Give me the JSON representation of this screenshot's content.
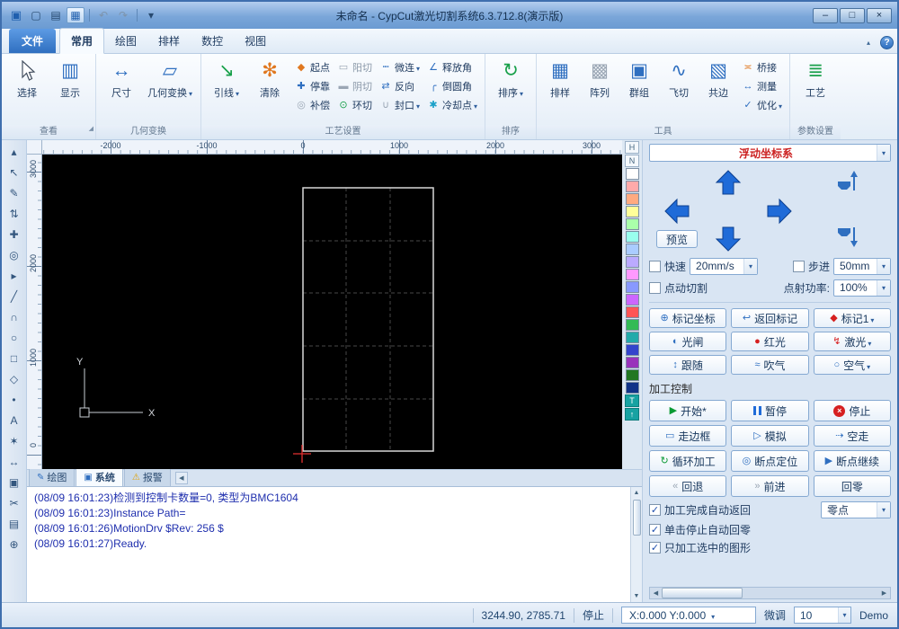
{
  "colors": {
    "accent": "#2f6fc0",
    "start_green": "#0a9a34",
    "stop_red": "#d62020",
    "warning_yellow": "#e0a000",
    "coord_red": "#cc2222",
    "canvas_bg": "#000000"
  },
  "titlebar": {
    "title": "未命名 - CypCut激光切割系统6.3.712.8(演示版)"
  },
  "window_controls": {
    "minimize": "–",
    "maximize": "□",
    "close": "×"
  },
  "qat": {
    "icons": [
      {
        "name": "app-icon",
        "glyph": "▣",
        "cls": "app"
      },
      {
        "name": "new-file-icon",
        "glyph": "▢",
        "cls": ""
      },
      {
        "name": "open-file-icon",
        "glyph": "▤",
        "cls": ""
      },
      {
        "name": "save-icon",
        "glyph": "▦",
        "cls": "save"
      },
      {
        "name": "undo-icon",
        "glyph": "↶",
        "cls": "disabled"
      },
      {
        "name": "redo-icon",
        "glyph": "↷",
        "cls": "disabled"
      },
      {
        "name": "qat-more-icon",
        "glyph": "▾",
        "cls": ""
      }
    ]
  },
  "help_label": "?",
  "menu_tabs": [
    {
      "label": "文件"
    },
    {
      "label": "常用"
    },
    {
      "label": "绘图"
    },
    {
      "label": "排样"
    },
    {
      "label": "数控"
    },
    {
      "label": "视图"
    }
  ],
  "ribbon": {
    "view": {
      "label": "查看",
      "select": {
        "label": "选择"
      },
      "display": {
        "label": "显示",
        "icon": "▥"
      }
    },
    "transform": {
      "label": "几何变换",
      "size": {
        "label": "尺寸",
        "icon": "↔"
      },
      "geo": {
        "label": "几何变换",
        "icon": "▱"
      }
    },
    "process": {
      "label": "工艺设置",
      "lead": {
        "label": "引线",
        "icon": "↘"
      },
      "clear": {
        "label": "清除",
        "icon": "✻"
      },
      "cols": [
        [
          {
            "label": "起点",
            "icon": "◆"
          },
          {
            "label": "停靠",
            "icon": "✚"
          },
          {
            "label": "补偿",
            "icon": "◎"
          }
        ],
        [
          {
            "label": "阳切",
            "icon": "▭"
          },
          {
            "label": "阴切",
            "icon": "▬"
          },
          {
            "label": "环切",
            "icon": "⊙"
          }
        ],
        [
          {
            "label": "微连",
            "icon": "┉"
          },
          {
            "label": "反向",
            "icon": "⇄"
          },
          {
            "label": "封口",
            "icon": "∪"
          }
        ],
        [
          {
            "label": "释放角",
            "icon": "∠"
          },
          {
            "label": "倒圆角",
            "icon": "╭"
          },
          {
            "label": "冷却点",
            "icon": "✱"
          }
        ]
      ]
    },
    "sort": {
      "label": "排序",
      "btn": {
        "label": "排序",
        "icon": "↻"
      }
    },
    "tools": {
      "label": "工具",
      "items": [
        {
          "label": "排样",
          "icon": "▦"
        },
        {
          "label": "阵列",
          "icon": "▩"
        },
        {
          "label": "群组",
          "icon": "▣"
        },
        {
          "label": "飞切",
          "icon": "∿"
        },
        {
          "label": "共边",
          "icon": "▧"
        }
      ],
      "small": [
        {
          "label": "桥接",
          "icon": "≍"
        },
        {
          "label": "测量",
          "icon": "↔"
        },
        {
          "label": "优化",
          "icon": "✓"
        }
      ]
    },
    "params": {
      "label": "参数设置",
      "craft": {
        "label": "工艺",
        "icon": "≣"
      }
    }
  },
  "rulers": {
    "h": [
      "-2000",
      "-1000",
      "0",
      "1000",
      "2000",
      "3000"
    ],
    "v": [
      "3000",
      "2000",
      "1000",
      "0"
    ]
  },
  "left_toolbar": {
    "icons": [
      {
        "name": "toolbar-scroll-up-icon",
        "glyph": "▴"
      },
      {
        "name": "select-tool-icon",
        "glyph": "↖"
      },
      {
        "name": "node-edit-tool-icon",
        "glyph": "✎"
      },
      {
        "name": "order-edit-tool-icon",
        "glyph": "⇅"
      },
      {
        "name": "pan-tool-icon",
        "glyph": "✚"
      },
      {
        "name": "zoom-tool-icon",
        "glyph": "◎"
      },
      {
        "name": "more-tools-icon",
        "glyph": "▸"
      },
      {
        "name": "line-tool-icon",
        "glyph": "╱"
      },
      {
        "name": "arc-tool-icon",
        "glyph": "∩"
      },
      {
        "name": "circle-tool-icon",
        "glyph": "○"
      },
      {
        "name": "rect-tool-icon",
        "glyph": "□"
      },
      {
        "name": "polygon-tool-icon",
        "glyph": "◇"
      },
      {
        "name": "point-tool-icon",
        "glyph": "•"
      },
      {
        "name": "text-tool-icon",
        "glyph": "A"
      },
      {
        "name": "star-tool-icon",
        "glyph": "✶"
      },
      {
        "name": "measure-tool-icon",
        "glyph": "↔"
      },
      {
        "name": "frame-tool-icon",
        "glyph": "▣"
      },
      {
        "name": "trim-tool-icon",
        "glyph": "✂"
      },
      {
        "name": "report-tool-icon",
        "glyph": "▤"
      },
      {
        "name": "origin-tool-icon",
        "glyph": "⊕"
      }
    ]
  },
  "palette": {
    "header": [
      {
        "name": "palette-h-icon",
        "glyph": "H"
      },
      {
        "name": "palette-n-icon",
        "glyph": "N"
      }
    ],
    "colors": [
      "#ffffff",
      "#ffaaaa",
      "#ffaa80",
      "#ffff99",
      "#aaffaa",
      "#99ffee",
      "#aaccff",
      "#bbaaff",
      "#ff99ff",
      "#8899ff",
      "#cc66ff",
      "#ff5555",
      "#33bb55",
      "#22aaaa",
      "#3344cc",
      "#9933bb",
      "#227722",
      "#113388"
    ],
    "footer": [
      {
        "name": "palette-t-icon",
        "glyph": "T"
      },
      {
        "name": "palette-up-icon",
        "glyph": "↑"
      }
    ]
  },
  "canvas": {
    "axis_x_label": "X",
    "axis_y_label": "Y"
  },
  "log": {
    "tabs": [
      {
        "label": "绘图",
        "icon": "✎"
      },
      {
        "label": "系统",
        "icon": "▣"
      },
      {
        "label": "报警",
        "icon": "⚠"
      }
    ],
    "lines": [
      "(08/09 16:01:23)检测到控制卡数量=0, 类型为BMC1604",
      "(08/09 16:01:23)Instance Path=",
      "(08/09 16:01:26)MotionDrv $Rev: 256 $",
      "(08/09 16:01:27)Ready."
    ]
  },
  "right_panel": {
    "coord_system": "浮动坐标系",
    "preview": "预览",
    "speed": {
      "label": "快速",
      "value": "20mm/s"
    },
    "step": {
      "label": "步进",
      "value": "50mm"
    },
    "jog_cut": "点动切割",
    "burst_power_label": "点射功率:",
    "burst_power_value": "100%",
    "mark_row": [
      {
        "label": "标记坐标",
        "icon": "⊕"
      },
      {
        "label": "返回标记",
        "icon": "↩"
      },
      {
        "label": "标记1",
        "icon": "◆"
      }
    ],
    "laser_row": [
      {
        "label": "光闸",
        "icon": "◐"
      },
      {
        "label": "红光",
        "icon": "●"
      },
      {
        "label": "激光",
        "icon": "↯"
      }
    ],
    "gas_row": [
      {
        "label": "跟随",
        "icon": "↕"
      },
      {
        "label": "吹气",
        "icon": "≈"
      },
      {
        "label": "空气",
        "icon": "○"
      }
    ],
    "control_header": "加工控制",
    "ctl": {
      "start": {
        "label": "开始*",
        "icon": "▶"
      },
      "pause": {
        "label": "暂停"
      },
      "stop": {
        "label": "停止"
      },
      "frame": {
        "label": "走边框",
        "icon": "▭"
      },
      "simulate": {
        "label": "模拟",
        "icon": "▷"
      },
      "dryrun": {
        "label": "空走",
        "icon": "⇢"
      },
      "loop": {
        "label": "循环加工",
        "icon": "↻"
      },
      "bp_locate": {
        "label": "断点定位",
        "icon": "◎"
      },
      "bp_resume": {
        "label": "断点继续",
        "icon": "▶"
      },
      "back": {
        "label": "回退",
        "icon": "«"
      },
      "forward": {
        "label": "前进",
        "icon": "»"
      },
      "home": {
        "label": "回零"
      }
    },
    "options": [
      {
        "label": "加工完成自动返回",
        "combo": "零点"
      },
      {
        "label": "单击停止自动回零"
      },
      {
        "label": "只加工选中的图形"
      }
    ]
  },
  "statusbar": {
    "coords": "3244.90, 2785.71",
    "state": "停止",
    "position": "X:0.000 Y:0.000",
    "fine_label": "微调",
    "fine_value": "10",
    "mode": "Demo"
  }
}
